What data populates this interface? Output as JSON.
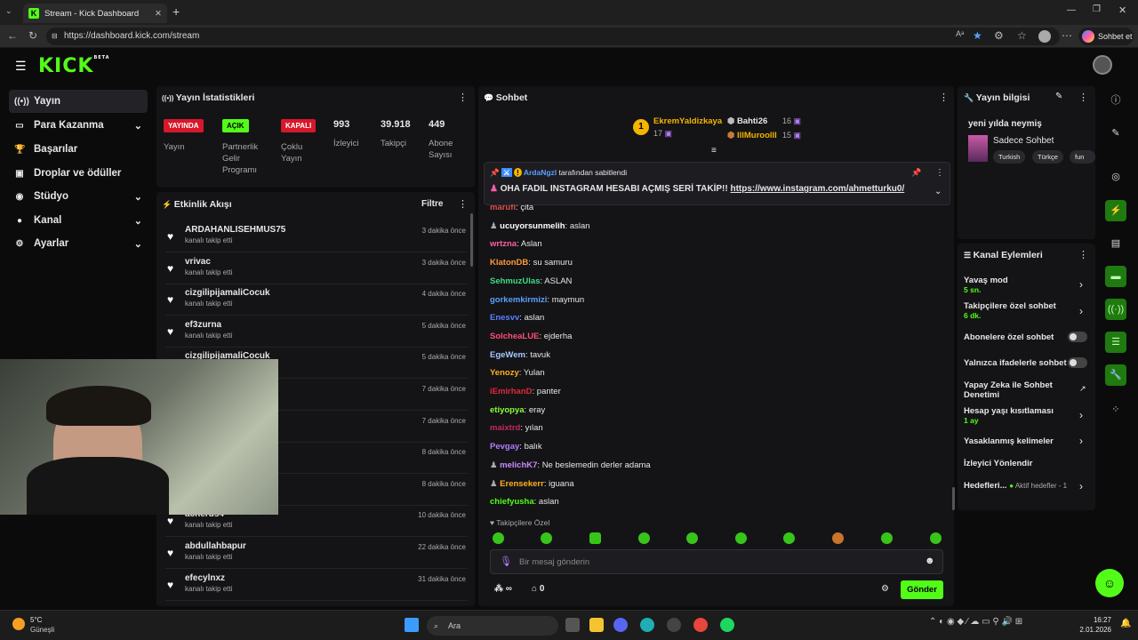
{
  "browser": {
    "tab_title": "Stream - Kick Dashboard",
    "url": "https://dashboard.kick.com/stream",
    "chat_button": "Sohbet et"
  },
  "app": {
    "logo": "KICK",
    "beta": "BETA"
  },
  "sidebar": {
    "items": [
      {
        "label": "Yayın"
      },
      {
        "label": "Para Kazanma"
      },
      {
        "label": "Başarılar"
      },
      {
        "label": "Droplar ve ödüller"
      },
      {
        "label": "Stüdyo"
      },
      {
        "label": "Kanal"
      },
      {
        "label": "Ayarlar"
      }
    ]
  },
  "stats": {
    "title": "Yayın İstatistikleri",
    "badge1": "YAYINDA",
    "label1": "Yayın",
    "badge2": "AÇIK",
    "label2": "Partnerlik Gelir Programı",
    "badge3": "KAPALI",
    "label3": "Çoklu Yayın",
    "val1": "993",
    "vlabel1": "İzleyici",
    "val2": "39.918",
    "vlabel2": "Takipçi",
    "val3": "449",
    "vlabel3": "Abone Sayısı"
  },
  "activity": {
    "title": "Etkinlik Akışı",
    "filter": "Filtre",
    "rows": [
      {
        "name": "ARDAHANLISEHMUS75",
        "sub": "kanalı takip etti",
        "time": "3 dakika önce"
      },
      {
        "name": "vrivac",
        "sub": "kanalı takip etti",
        "time": "3 dakika önce"
      },
      {
        "name": "cizgilipijamaliCocuk",
        "sub": "kanalı takip etti",
        "time": "4 dakika önce"
      },
      {
        "name": "ef3zurna",
        "sub": "kanalı takip etti",
        "time": "5 dakika önce"
      },
      {
        "name": "cizgilipijamaliCocuk",
        "sub": "",
        "time": "5 dakika önce"
      },
      {
        "name": "",
        "sub": "",
        "time": "7 dakika önce"
      },
      {
        "name": "",
        "sub": "",
        "time": "7 dakika önce"
      },
      {
        "name": "",
        "sub": "",
        "time": "8 dakika önce"
      },
      {
        "name": "",
        "sub": "",
        "time": "8 dakika önce"
      },
      {
        "name": "acherus4",
        "sub": "kanalı takip etti",
        "time": "10 dakika önce"
      },
      {
        "name": "abdullahbapur",
        "sub": "kanalı takip etti",
        "time": "22 dakika önce"
      },
      {
        "name": "efecylnxz",
        "sub": "kanalı takip etti",
        "time": "31 dakika önce"
      }
    ]
  },
  "chat": {
    "title": "Sohbet",
    "top1_name": "EkremYaldizkaya",
    "top1_rank": "1",
    "top1_count": "17",
    "top2_name": "Bahti26",
    "top2_count": "16",
    "top3_name": "lllMuroolll",
    "top3_count": "15",
    "pinned_by": "ArdaNgzl",
    "pinned_suffix": "tarafından sabitlendi",
    "pinned_text": "OHA FADIL INSTAGRAM HESABI AÇMIŞ SERİ TAKİP!!",
    "pinned_link": "https://www.instagram.com/ahmetturku0/",
    "messages": [
      {
        "user": "marufi",
        "text": "çita",
        "color": "#e24d4d"
      },
      {
        "user": "ucuyorsunmelih",
        "text": "aslan",
        "color": "#ffffff"
      },
      {
        "user": "wrtzna",
        "text": "Aslan",
        "color": "#ff5ca8"
      },
      {
        "user": "KlatonDB",
        "text": "su samuru",
        "color": "#ff9a3c"
      },
      {
        "user": "SehmuzUlas",
        "text": "ASLAN",
        "color": "#3ddc84"
      },
      {
        "user": "gorkemkirmizi",
        "text": "maymun",
        "color": "#5aa0ff"
      },
      {
        "user": "Enesvv",
        "text": "aslan",
        "color": "#5a7dff"
      },
      {
        "user": "SolcheaLUE",
        "text": "ejderha",
        "color": "#ff4d7a"
      },
      {
        "user": "EgeWem",
        "text": "tavuk",
        "color": "#a8c8ff"
      },
      {
        "user": "Yenozy",
        "text": "Yulan",
        "color": "#ffb020"
      },
      {
        "user": "iEmirhanD",
        "text": "panter",
        "color": "#e0283c"
      },
      {
        "user": "etiyopya",
        "text": "eray",
        "color": "#8cff3a"
      },
      {
        "user": "maixtrd",
        "text": "yılan",
        "color": "#c02a5a"
      },
      {
        "user": "Pevgay",
        "text": "balık",
        "color": "#b57cff"
      },
      {
        "user": "melichK7",
        "text": "Ne beslemedin derler adama",
        "color": "#c88cff"
      },
      {
        "user": "Erensekerr",
        "text": "iguana",
        "color": "#ffb020"
      },
      {
        "user": "chiefyusha",
        "text": "aslan",
        "color": "#53fc18"
      }
    ],
    "followers_only": "Takipçilere Özel",
    "input_placeholder": "Bir mesaj gönderin",
    "points": "∞",
    "store_count": "0",
    "send": "Gönder"
  },
  "stream_info": {
    "title": "Yayın bilgisi",
    "stream_title": "yeni yılda neymiş",
    "category": "Sadece Sohbet",
    "tags": [
      "Turkish",
      "Türkçe",
      "fun"
    ]
  },
  "channel_actions": {
    "title": "Kanal Eylemleri",
    "slow": "Yavaş mod",
    "slow_val": "5 sn.",
    "followers": "Takipçilere özel sohbet",
    "followers_val": "6 dk.",
    "subs": "Abonelere özel sohbet",
    "emotes": "Yalnızca ifadelerle sohbet",
    "ai": "Yapay Zeka ile Sohbet Denetimi",
    "age": "Hesap yaşı kısıtlaması",
    "age_val": "1 ay",
    "banned": "Yasaklanmış kelimeler",
    "redirect": "İzleyici Yönlendir",
    "goals": "Hedefleri...",
    "goals_sub": "Aktif hedefler - 1"
  },
  "taskbar": {
    "temp": "5°C",
    "weather": "Güneşli",
    "search": "Ara",
    "time": "16:27",
    "date": "2.01.2026"
  }
}
